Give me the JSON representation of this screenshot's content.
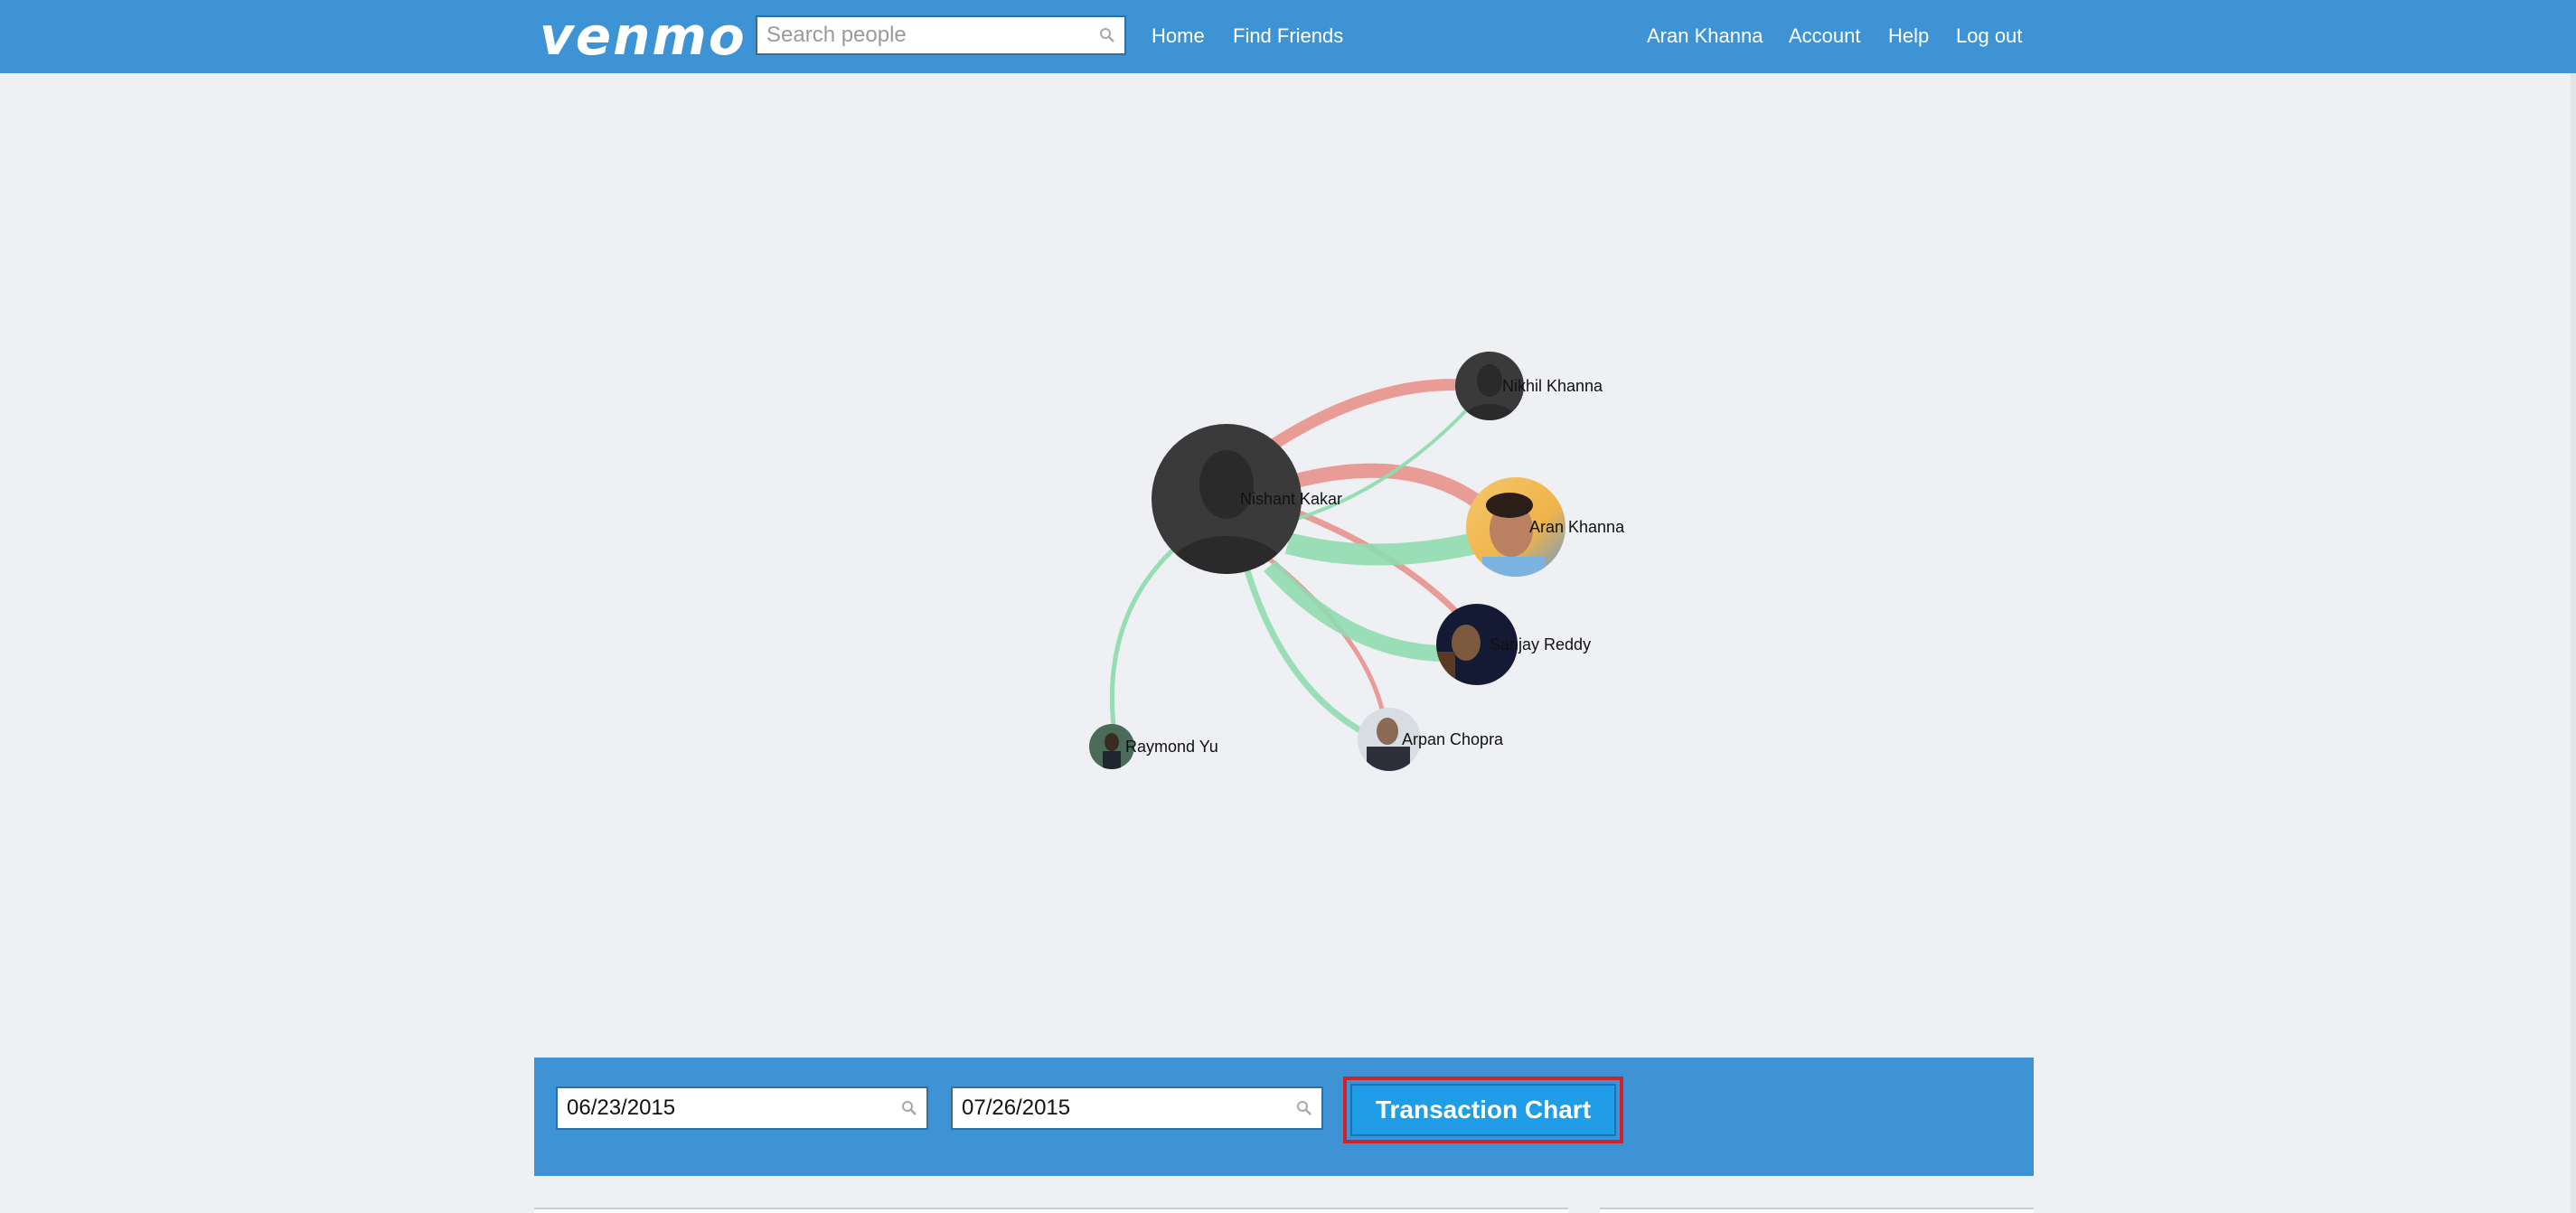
{
  "header": {
    "logo_text": "venmo",
    "search_placeholder": "Search people",
    "nav_left": [
      "Home",
      "Find Friends"
    ],
    "nav_right": [
      "Aran Khanna",
      "Account",
      "Help",
      "Log out"
    ],
    "brand_color": "#3d93d4"
  },
  "graph": {
    "center_node": "Nishant Kakar",
    "nodes": [
      {
        "name": "Nikhil Khanna"
      },
      {
        "name": "Nishant Kakar"
      },
      {
        "name": "Aran Khanna"
      },
      {
        "name": "Sanjay Reddy"
      },
      {
        "name": "Arpan Chopra"
      },
      {
        "name": "Raymond Yu"
      }
    ],
    "link_colors": {
      "paid": "#e8928c",
      "received": "#8fdcb0"
    }
  },
  "controls": {
    "start_date": "06/23/2015",
    "end_date": "07/26/2015",
    "chart_button_label": "Transaction Chart",
    "highlight_color": "#d0222a"
  }
}
